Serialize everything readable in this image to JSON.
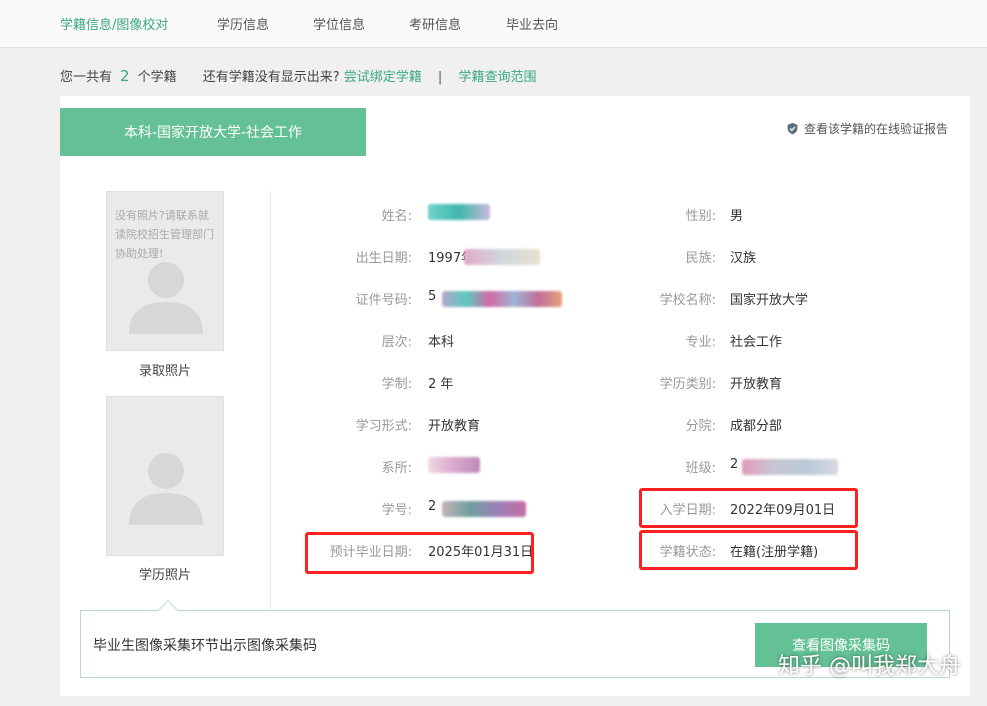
{
  "nav": {
    "tabs": [
      {
        "label": "学籍信息/图像校对"
      },
      {
        "label": "学历信息"
      },
      {
        "label": "学位信息"
      },
      {
        "label": "考研信息"
      },
      {
        "label": "毕业去向"
      }
    ]
  },
  "summary": {
    "prefix": "您一共有",
    "count": "2",
    "suffix": "个学籍",
    "question": "还有学籍没有显示出来?",
    "bind_link": "尝试绑定学籍",
    "separator": "|",
    "scope_link": "学籍查询范围"
  },
  "record": {
    "title": "本科-国家开放大学-社会工作",
    "verify_link": "查看该学籍的在线验证报告",
    "photos": {
      "no_photo_text": "没有照片?请联系就读院校招生管理部门协助处理!",
      "admission_label": "录取照片",
      "diploma_label": "学历照片"
    },
    "left_fields": [
      {
        "label": "姓名:",
        "value": ""
      },
      {
        "label": "出生日期:",
        "value": "1997年"
      },
      {
        "label": "证件号码:",
        "value": "5"
      },
      {
        "label": "层次:",
        "value": "本科"
      },
      {
        "label": "学制:",
        "value": "2 年"
      },
      {
        "label": "学习形式:",
        "value": "开放教育"
      },
      {
        "label": "系所:",
        "value": ""
      },
      {
        "label": "学号:",
        "value": "2"
      },
      {
        "label": "预计毕业日期:",
        "value": "2025年01月31日"
      }
    ],
    "right_fields": [
      {
        "label": "性别:",
        "value": "男"
      },
      {
        "label": "民族:",
        "value": "汉族"
      },
      {
        "label": "学校名称:",
        "value": "国家开放大学"
      },
      {
        "label": "专业:",
        "value": "社会工作"
      },
      {
        "label": "学历类别:",
        "value": "开放教育"
      },
      {
        "label": "分院:",
        "value": "成都分部"
      },
      {
        "label": "班级:",
        "value": "2"
      },
      {
        "label": "入学日期:",
        "value": "2022年09月01日"
      },
      {
        "label": "学籍状态:",
        "value": "在籍(注册学籍)"
      }
    ]
  },
  "bottom": {
    "text": "毕业生图像采集环节出示图像采集码",
    "button": "查看图像采集码"
  },
  "watermark": "知乎 @叫我郑大舟",
  "colors": {
    "accent": "#64c195",
    "accent_text": "#3aa87f",
    "highlight": "#ff2020"
  },
  "icons": {
    "verify": "shield-check-icon",
    "avatar": "avatar-placeholder-icon"
  }
}
